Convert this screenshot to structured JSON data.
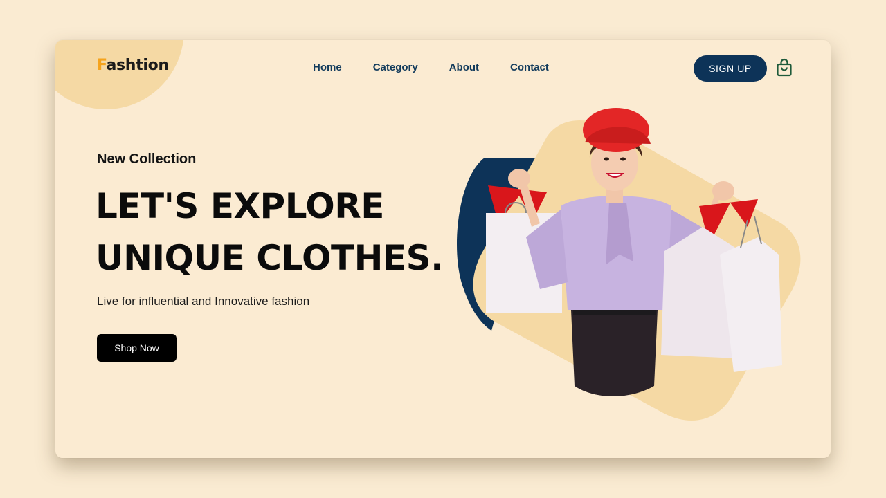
{
  "brand": {
    "logo_first": "F",
    "logo_rest": "ashtion"
  },
  "nav": {
    "home": "Home",
    "category": "Category",
    "about": "About",
    "contact": "Contact"
  },
  "header": {
    "signup_label": "SIGN UP",
    "cart_icon": "shopping-bag-icon"
  },
  "hero": {
    "kicker": "New Collection",
    "headline_line1": "LET'S EXPLORE",
    "headline_line2": "UNIQUE CLOTHES.",
    "subtitle": "Live for influential and Innovative fashion",
    "cta_label": "Shop Now",
    "image": "woman-with-shopping-bags"
  },
  "colors": {
    "background": "#fbebd2",
    "accent": "#f5a31c",
    "navy": "#0d3358",
    "blob": "#f5d9a4"
  }
}
